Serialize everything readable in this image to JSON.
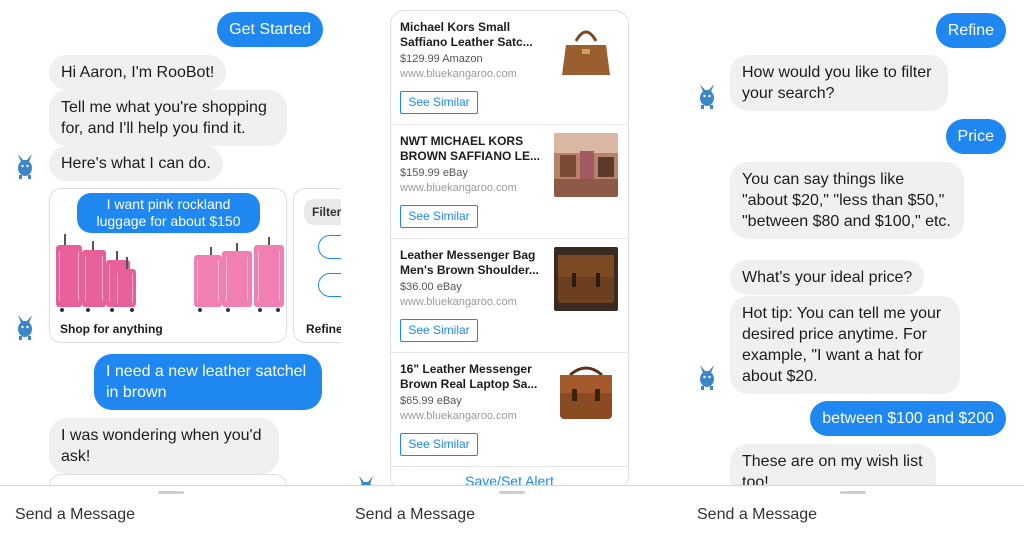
{
  "colors": {
    "accent": "#1e88f0",
    "bot_bubble": "#f1f0f0",
    "luggage_pink": "#e8609b"
  },
  "panel1": {
    "get_started": "Get Started",
    "greeting": "Hi Aaron, I'm RooBot!",
    "tell_me": "Tell me what you're shopping for, and I'll help you find it.",
    "heres_what": "Here's what I can do.",
    "carousel": {
      "card1_chip": "I want pink rockland luggage for about $150",
      "card1_title": "Shop for anything",
      "card2_chip": "Filter",
      "card2_title": "Refine"
    },
    "user_msg": "I need a new leather satchel in brown",
    "bot_reply": "I was wondering when you'd ask!",
    "composer_placeholder": "Send a Message"
  },
  "panel2": {
    "products": [
      {
        "title": "Michael Kors Small Saffiano Leather Satc...",
        "price": "$129.99 Amazon",
        "source": "www.bluekangaroo.com",
        "button": "See Similar",
        "image_icon": "brown-handbag-icon"
      },
      {
        "title": "NWT MICHAEL KORS BROWN SAFFIANO LE...",
        "price": "$159.99 eBay",
        "source": "www.bluekangaroo.com",
        "button": "See Similar",
        "image_icon": "store-display-photo-icon"
      },
      {
        "title": "Leather Messenger Bag Men's Brown Shoulder...",
        "price": "$36.00 eBay",
        "source": "www.bluekangaroo.com",
        "button": "See Similar",
        "image_icon": "messenger-bag-icon"
      },
      {
        "title": "16\" Leather Messenger Brown Real Laptop Sa...",
        "price": "$65.99 eBay",
        "source": "www.bluekangaroo.com",
        "button": "See Similar",
        "image_icon": "laptop-bag-icon"
      }
    ],
    "save_alert": "Save/Set Alert",
    "composer_placeholder": "Send a Message"
  },
  "panel3": {
    "refine": "Refine",
    "how_filter": "How would you like to filter your search?",
    "price": "Price",
    "you_can_say": "You can say things like \"about $20,\" \"less than $50,\" \"between $80 and $100,\" etc.",
    "ideal_price": "What's your ideal price?",
    "hot_tip": "Hot tip: You can tell me your desired price anytime. For example, \"I want a hat for about $20.",
    "user_range": "between $100 and $200",
    "wishlist": "These are on my wish list too!",
    "composer_placeholder": "Send a Message"
  }
}
